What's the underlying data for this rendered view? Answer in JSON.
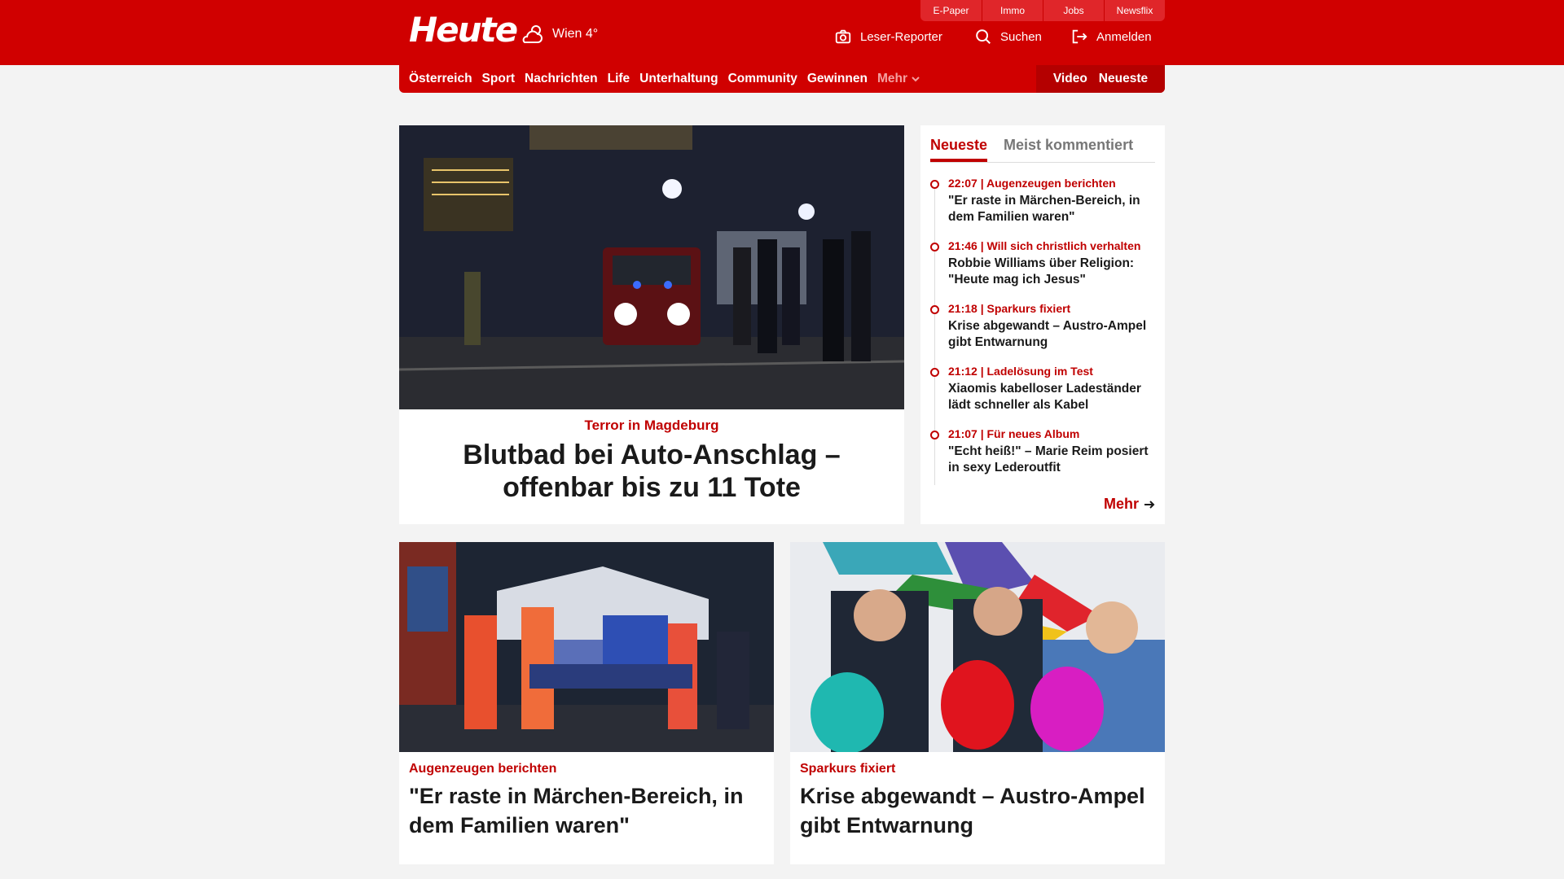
{
  "header": {
    "logo": "Heute",
    "weather": {
      "icon": "cloud-sun-icon",
      "text": "Wien 4°"
    },
    "util_links": [
      "E-Paper",
      "Immo",
      "Jobs",
      "Newsflix"
    ],
    "actions": [
      {
        "icon": "camera-icon",
        "label": "Leser-Reporter"
      },
      {
        "icon": "search-icon",
        "label": "Suchen"
      },
      {
        "icon": "login-icon",
        "label": "Anmelden"
      }
    ]
  },
  "nav": {
    "items": [
      "Österreich",
      "Sport",
      "Nachrichten",
      "Life",
      "Unterhaltung",
      "Community",
      "Gewinnen"
    ],
    "more": "Mehr",
    "right": [
      "Video",
      "Neueste"
    ]
  },
  "hero": {
    "kicker": "Terror in Magdeburg",
    "title": "Blutbad bei Auto-Anschlag – offenbar bis zu 11 Tote"
  },
  "sidebar": {
    "tabs": [
      "Neueste",
      "Meist kommentiert"
    ],
    "items": [
      {
        "meta": "22:07 | Augenzeugen berichten",
        "title": "\"Er raste in Märchen-Bereich, in dem Familien waren\""
      },
      {
        "meta": "21:46 | Will sich christlich verhalten",
        "title": "Robbie Williams über Religion: \"Heute mag ich Jesus\""
      },
      {
        "meta": "21:18 | Sparkurs fixiert",
        "title": "Krise abgewandt – Austro-Ampel gibt Entwarnung"
      },
      {
        "meta": "21:12 | Ladelösung im Test",
        "title": "Xiaomis kabelloser Ladeständer lädt schneller als Kabel"
      },
      {
        "meta": "21:07 | Für neues Album",
        "title": "\"Echt heiß!\" – Marie Reim posiert in sexy Lederoutfit"
      }
    ],
    "more": "Mehr"
  },
  "cards": [
    {
      "kicker": "Augenzeugen berichten",
      "title": "\"Er raste in Märchen-Bereich, in dem Familien waren\""
    },
    {
      "kicker": "Sparkurs fixiert",
      "title": "Krise abgewandt – Austro-Ampel gibt Entwarnung"
    }
  ],
  "colors": {
    "brand": "#d00000",
    "brand_dark": "#b40000",
    "accent_text": "#c00000",
    "background": "#f3f3f3"
  }
}
